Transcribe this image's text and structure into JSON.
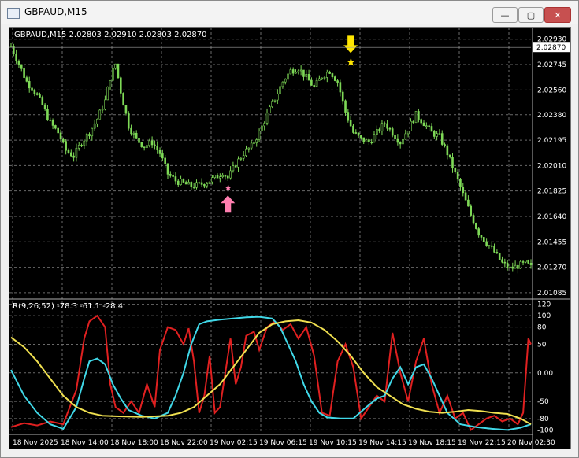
{
  "window": {
    "title": "GBPAUD,M15",
    "min_label": "—",
    "max_label": "▢",
    "close_label": "✕"
  },
  "chart_data": [
    {
      "type": "candlestick",
      "symbol": "GBPAUD",
      "timeframe": "M15",
      "header": "GBPAUD,M15  2.02803 2.02910 2.02803 2.02870",
      "ohlc_readout": {
        "open": 2.02803,
        "high": 2.0291,
        "low": 2.02803,
        "close": 2.0287
      },
      "current_price": "2.02870",
      "y_ticks": [
        "2.02930",
        "2.02745",
        "2.02560",
        "2.02380",
        "2.02195",
        "2.02010",
        "2.01825",
        "2.01640",
        "2.01455",
        "2.01270",
        "2.01085"
      ],
      "ylim": [
        2.0105,
        2.0298
      ],
      "grid": true,
      "color": "#7ed957",
      "close_path": [
        [
          0,
          2.0288
        ],
        [
          3,
          2.0275
        ],
        [
          6,
          2.0262
        ],
        [
          9,
          2.0255
        ],
        [
          12,
          2.0245
        ],
        [
          15,
          2.0232
        ],
        [
          18,
          2.0225
        ],
        [
          21,
          2.0212
        ],
        [
          24,
          2.0208
        ],
        [
          27,
          2.0218
        ],
        [
          30,
          2.0225
        ],
        [
          33,
          2.0235
        ],
        [
          36,
          2.0248
        ],
        [
          38,
          2.0265
        ],
        [
          40,
          2.0275
        ],
        [
          42,
          2.0255
        ],
        [
          45,
          2.023
        ],
        [
          48,
          2.022
        ],
        [
          51,
          2.0215
        ],
        [
          54,
          2.0218
        ],
        [
          57,
          2.021
        ],
        [
          60,
          2.0195
        ],
        [
          63,
          2.019
        ],
        [
          66,
          2.0188
        ],
        [
          69,
          2.0186
        ],
        [
          72,
          2.0187
        ],
        [
          75,
          2.0189
        ],
        [
          78,
          2.0192
        ],
        [
          81,
          2.0196
        ],
        [
          83,
          2.0192
        ],
        [
          86,
          2.0202
        ],
        [
          89,
          2.021
        ],
        [
          92,
          2.0215
        ],
        [
          95,
          2.0225
        ],
        [
          98,
          2.0238
        ],
        [
          101,
          2.025
        ],
        [
          104,
          2.0262
        ],
        [
          107,
          2.027
        ],
        [
          110,
          2.0272
        ],
        [
          113,
          2.0265
        ],
        [
          116,
          2.0258
        ],
        [
          119,
          2.0266
        ],
        [
          122,
          2.027
        ],
        [
          125,
          2.0262
        ],
        [
          128,
          2.024
        ],
        [
          131,
          2.0225
        ],
        [
          134,
          2.022
        ],
        [
          137,
          2.0218
        ],
        [
          140,
          2.0225
        ],
        [
          143,
          2.0232
        ],
        [
          146,
          2.0225
        ],
        [
          149,
          2.0218
        ],
        [
          152,
          2.0228
        ],
        [
          155,
          2.0238
        ],
        [
          158,
          2.0232
        ],
        [
          161,
          2.0225
        ],
        [
          164,
          2.0222
        ],
        [
          167,
          2.021
        ],
        [
          170,
          2.0195
        ],
        [
          173,
          2.018
        ],
        [
          176,
          2.0165
        ],
        [
          179,
          2.0152
        ],
        [
          182,
          2.0145
        ],
        [
          185,
          2.0138
        ],
        [
          188,
          2.013
        ],
        [
          191,
          2.0126
        ],
        [
          194,
          2.0128
        ],
        [
          197,
          2.013
        ],
        [
          199,
          2.0127
        ]
      ],
      "markers": [
        {
          "kind": "up-arrow",
          "color": "#ff7fb0",
          "x": 83,
          "price": 2.0185
        },
        {
          "kind": "down-arrow",
          "color": "#ffe600",
          "x": 130,
          "price": 2.0276
        }
      ]
    },
    {
      "type": "line",
      "header": "R(9,26,52) -78.3 -61.1 -28.4",
      "y_ticks": [
        "120",
        "100",
        "80",
        "50",
        "0.00",
        "-50",
        "-80",
        "-100"
      ],
      "ylim": [
        -105,
        125
      ],
      "grid": true,
      "series": [
        {
          "color": "#e02020",
          "values": [
            [
              0,
              -95
            ],
            [
              5,
              -88
            ],
            [
              10,
              -92
            ],
            [
              15,
              -85
            ],
            [
              20,
              -90
            ],
            [
              25,
              -30
            ],
            [
              28,
              60
            ],
            [
              30,
              90
            ],
            [
              33,
              100
            ],
            [
              36,
              80
            ],
            [
              38,
              -20
            ],
            [
              40,
              -60
            ],
            [
              43,
              -70
            ],
            [
              46,
              -50
            ],
            [
              49,
              -70
            ],
            [
              52,
              -20
            ],
            [
              55,
              -60
            ],
            [
              57,
              40
            ],
            [
              60,
              80
            ],
            [
              63,
              75
            ],
            [
              66,
              50
            ],
            [
              68,
              78
            ],
            [
              70,
              20
            ],
            [
              72,
              -70
            ],
            [
              74,
              -40
            ],
            [
              76,
              30
            ],
            [
              78,
              -70
            ],
            [
              80,
              -60
            ],
            [
              82,
              0
            ],
            [
              84,
              60
            ],
            [
              86,
              -20
            ],
            [
              88,
              10
            ],
            [
              90,
              65
            ],
            [
              93,
              72
            ],
            [
              95,
              40
            ],
            [
              98,
              80
            ],
            [
              101,
              90
            ],
            [
              104,
              75
            ],
            [
              107,
              85
            ],
            [
              110,
              60
            ],
            [
              113,
              80
            ],
            [
              116,
              30
            ],
            [
              119,
              -70
            ],
            [
              122,
              -75
            ],
            [
              125,
              20
            ],
            [
              128,
              50
            ],
            [
              131,
              10
            ],
            [
              134,
              -80
            ],
            [
              137,
              -60
            ],
            [
              140,
              -40
            ],
            [
              143,
              -50
            ],
            [
              146,
              70
            ],
            [
              149,
              0
            ],
            [
              152,
              -50
            ],
            [
              155,
              20
            ],
            [
              158,
              60
            ],
            [
              161,
              -20
            ],
            [
              164,
              -70
            ],
            [
              167,
              -40
            ],
            [
              170,
              -80
            ],
            [
              173,
              -70
            ],
            [
              176,
              -100
            ],
            [
              179,
              -90
            ],
            [
              182,
              -80
            ],
            [
              185,
              -75
            ],
            [
              188,
              -85
            ],
            [
              191,
              -80
            ],
            [
              194,
              -90
            ],
            [
              196,
              -70
            ],
            [
              198,
              60
            ],
            [
              199,
              50
            ]
          ]
        },
        {
          "color": "#40d8e8",
          "values": [
            [
              0,
              5
            ],
            [
              5,
              -40
            ],
            [
              10,
              -70
            ],
            [
              15,
              -90
            ],
            [
              20,
              -98
            ],
            [
              25,
              -60
            ],
            [
              28,
              -10
            ],
            [
              30,
              20
            ],
            [
              33,
              25
            ],
            [
              36,
              15
            ],
            [
              39,
              -20
            ],
            [
              42,
              -45
            ],
            [
              45,
              -65
            ],
            [
              50,
              -75
            ],
            [
              55,
              -80
            ],
            [
              60,
              -70
            ],
            [
              63,
              -40
            ],
            [
              66,
              0
            ],
            [
              69,
              50
            ],
            [
              72,
              85
            ],
            [
              75,
              90
            ],
            [
              80,
              93
            ],
            [
              85,
              95
            ],
            [
              90,
              97
            ],
            [
              95,
              98
            ],
            [
              100,
              95
            ],
            [
              103,
              80
            ],
            [
              106,
              50
            ],
            [
              109,
              20
            ],
            [
              112,
              -20
            ],
            [
              115,
              -50
            ],
            [
              118,
              -70
            ],
            [
              121,
              -78
            ],
            [
              126,
              -80
            ],
            [
              131,
              -80
            ],
            [
              136,
              -60
            ],
            [
              140,
              -45
            ],
            [
              143,
              -40
            ],
            [
              146,
              -10
            ],
            [
              149,
              10
            ],
            [
              152,
              -20
            ],
            [
              155,
              10
            ],
            [
              158,
              15
            ],
            [
              161,
              -10
            ],
            [
              164,
              -40
            ],
            [
              167,
              -70
            ],
            [
              172,
              -90
            ],
            [
              178,
              -95
            ],
            [
              184,
              -98
            ],
            [
              190,
              -100
            ],
            [
              195,
              -96
            ],
            [
              199,
              -90
            ]
          ]
        },
        {
          "color": "#f0e050",
          "values": [
            [
              0,
              62
            ],
            [
              5,
              45
            ],
            [
              10,
              20
            ],
            [
              15,
              -10
            ],
            [
              20,
              -40
            ],
            [
              25,
              -60
            ],
            [
              30,
              -70
            ],
            [
              35,
              -75
            ],
            [
              40,
              -76
            ],
            [
              50,
              -77
            ],
            [
              60,
              -75
            ],
            [
              65,
              -70
            ],
            [
              70,
              -60
            ],
            [
              75,
              -40
            ],
            [
              80,
              -20
            ],
            [
              85,
              10
            ],
            [
              90,
              40
            ],
            [
              95,
              70
            ],
            [
              100,
              85
            ],
            [
              105,
              90
            ],
            [
              110,
              92
            ],
            [
              115,
              88
            ],
            [
              120,
              75
            ],
            [
              125,
              55
            ],
            [
              130,
              30
            ],
            [
              135,
              0
            ],
            [
              140,
              -25
            ],
            [
              145,
              -40
            ],
            [
              150,
              -55
            ],
            [
              155,
              -63
            ],
            [
              160,
              -68
            ],
            [
              165,
              -70
            ],
            [
              170,
              -68
            ],
            [
              175,
              -65
            ],
            [
              180,
              -67
            ],
            [
              185,
              -70
            ],
            [
              190,
              -72
            ],
            [
              195,
              -80
            ],
            [
              199,
              -90
            ]
          ]
        }
      ]
    }
  ],
  "x_ticks": [
    "18 Nov 2025",
    "18 Nov 14:00",
    "18 Nov 18:00",
    "18 Nov 22:00",
    "19 Nov 02:15",
    "19 Nov 06:15",
    "19 Nov 10:15",
    "19 Nov 14:15",
    "19 Nov 18:15",
    "19 Nov 22:15",
    "20 Nov 02:30"
  ]
}
